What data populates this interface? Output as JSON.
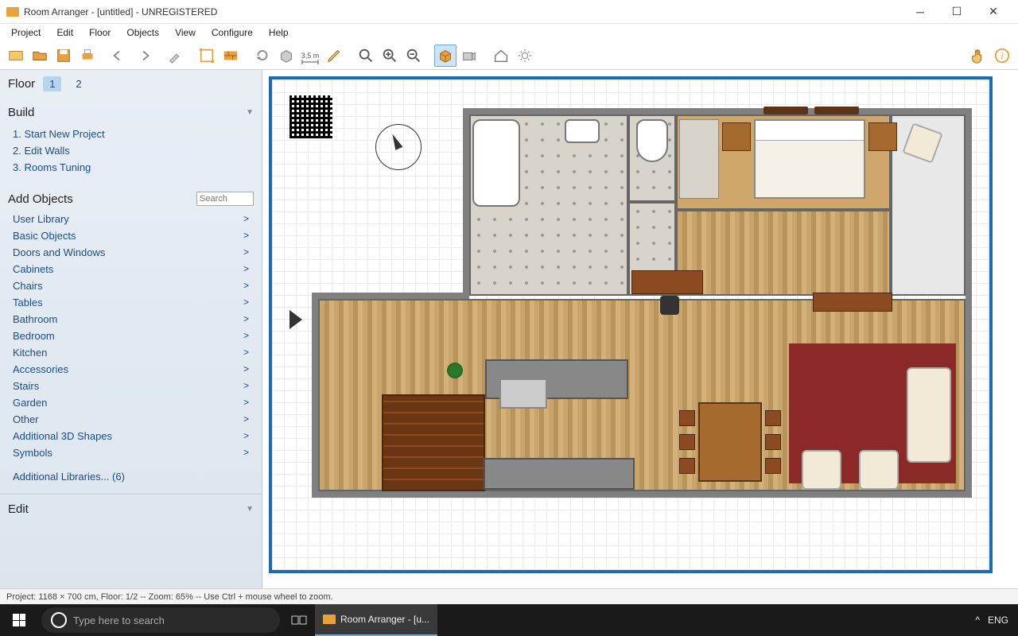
{
  "titlebar": {
    "title": "Room Arranger - [untitled] - UNREGISTERED"
  },
  "menu": {
    "items": [
      "Project",
      "Edit",
      "Floor",
      "Objects",
      "View",
      "Configure",
      "Help"
    ]
  },
  "toolbar_distance": "3,5 m",
  "sidebar": {
    "floor_label": "Floor",
    "floors": [
      "1",
      "2"
    ],
    "active_floor": "1",
    "build_header": "Build",
    "build_items": [
      "1. Start New Project",
      "2. Edit Walls",
      "3. Rooms Tuning"
    ],
    "add_header": "Add Objects",
    "search_placeholder": "Search",
    "categories": [
      "User Library",
      "Basic Objects",
      "Doors and Windows",
      "Cabinets",
      "Chairs",
      "Tables",
      "Bathroom",
      "Bedroom",
      "Kitchen",
      "Accessories",
      "Stairs",
      "Garden",
      "Other",
      "Additional 3D Shapes",
      "Symbols"
    ],
    "additional_libraries": "Additional Libraries... (6)",
    "edit_header": "Edit"
  },
  "statusbar": {
    "text": "Project: 1168 × 700 cm, Floor: 1/2 -- Zoom: 65% -- Use Ctrl + mouse wheel to zoom."
  },
  "taskbar": {
    "search_placeholder": "Type here to search",
    "app_label": "Room Arranger - [u...",
    "lang": "ENG"
  }
}
